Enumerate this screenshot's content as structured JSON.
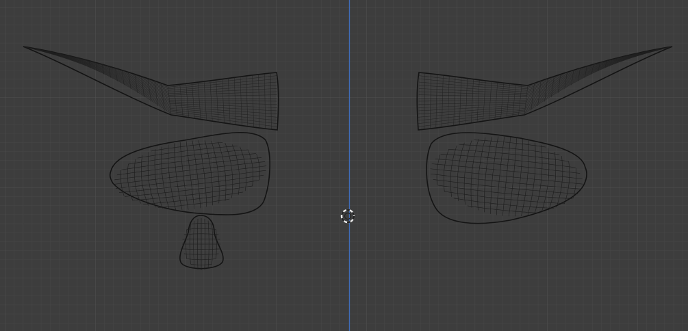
{
  "viewport": {
    "mode": "wireframe",
    "view": "front-orthographic",
    "background_color": "#3d3d3d",
    "grid": true,
    "grid_color_minor": "#474747",
    "grid_color_major": "#525252",
    "axis_color": "#3f6cb8",
    "wire_color": "#1c1c1c",
    "objects": [
      {
        "name": "left-eyebrow",
        "type": "mesh"
      },
      {
        "name": "right-eyebrow",
        "type": "mesh"
      },
      {
        "name": "left-eye",
        "type": "mesh"
      },
      {
        "name": "right-eye",
        "type": "mesh"
      },
      {
        "name": "tear-drop",
        "type": "mesh"
      }
    ],
    "cursor": "3d-cursor"
  }
}
